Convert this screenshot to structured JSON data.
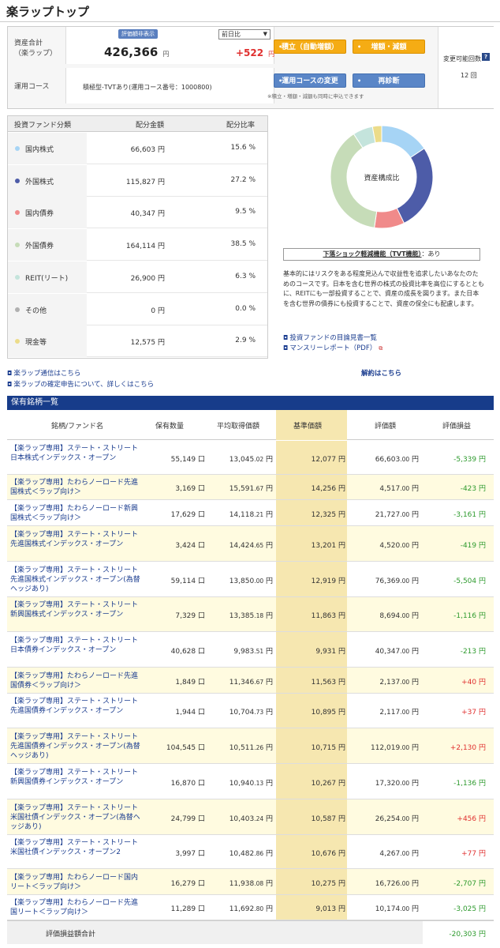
{
  "page": {
    "title": "楽ラップトップ"
  },
  "summary": {
    "asset_total_label_1": "資産合計",
    "asset_total_label_2": "（楽ラップ）",
    "badge": "評価額非表示",
    "total_value": "426,366",
    "yen": "円",
    "compare_select": "前日比",
    "change_value": "+522",
    "course_label": "運用コース",
    "course_value": "積極型-TVTあり(運用コース番号：1000800)",
    "buttons": {
      "accumulate": "積立（自動増額）",
      "increase": "増額・減額",
      "change_course": "運用コースの変更",
      "rediagnose": "再診断"
    },
    "note": "※積立・増額・減額も同時に申込できます",
    "changes_label": "変更可能回数",
    "changes_value": "12 回",
    "help": "?"
  },
  "allocation": {
    "headers": {
      "category": "投資ファンド分類",
      "amount": "配分金額",
      "ratio": "配分比率"
    },
    "rows": [
      {
        "label": "国内株式",
        "amount": "66,603 円",
        "ratio": "15.6 %",
        "color": "#a6d4f5"
      },
      {
        "label": "外国株式",
        "amount": "115,827 円",
        "ratio": "27.2 %",
        "color": "#4d5ca8"
      },
      {
        "label": "国内債券",
        "amount": "40,347 円",
        "ratio": "9.5 %",
        "color": "#f08a8a"
      },
      {
        "label": "外国債券",
        "amount": "164,114 円",
        "ratio": "38.5 %",
        "color": "#c6dcb8"
      },
      {
        "label": "REIT(リート)",
        "amount": "26,900 円",
        "ratio": "6.3 %",
        "color": "#c4e4dc"
      },
      {
        "label": "その他",
        "amount": "0 円",
        "ratio": "0.0 %",
        "color": "#b0b0b0"
      },
      {
        "label": "現金等",
        "amount": "12,575 円",
        "ratio": "2.9 %",
        "color": "#ecdc8a"
      }
    ]
  },
  "donut": {
    "label": "資産構成比"
  },
  "tvt": {
    "label": "下落ショック軽減機能（TVT機能）",
    "value": "：あり"
  },
  "description": "基本的にはリスクをある程度見込んで収益性を追求したいあなたのためのコースです。日本を含む世界の株式の投資比率を高位にするとともに、REITにも一部投資することで、資産の成長を図ります。また日本を含む世界の債券にも投資することで、資産の保全にも配慮します。",
  "links": {
    "prospectus": "投資ファンドの目論見書一覧",
    "monthly": "マンスリーレポート（PDF）",
    "news": "楽ラップ通信はこちら",
    "tax": "楽ラップの確定申告について、詳しくはこちら",
    "cancel": "解約はこちら"
  },
  "holdings": {
    "title": "保有銘柄一覧",
    "headers": [
      "銘柄/ファンド名",
      "保有数量",
      "平均取得価額",
      "基準価額",
      "評価額",
      "評価損益"
    ],
    "rows": [
      {
        "name": "【楽ラップ専用】ステート・ストリート日本株式インデックス・オープン",
        "qty": "55,149 口",
        "avg_main": "13,045",
        "avg_dec": ".02",
        "nav": "12,077 円",
        "val_main": "66,603",
        "val_dec": ".00",
        "pl": "-5,339 円"
      },
      {
        "name": "【楽ラップ専用】たわらノーロード先進国株式＜ラップ向け＞",
        "qty": "3,169 口",
        "avg_main": "15,591",
        "avg_dec": ".67",
        "nav": "14,256 円",
        "val_main": "4,517",
        "val_dec": ".00",
        "pl": "-423 円"
      },
      {
        "name": "【楽ラップ専用】たわらノーロード新興国株式＜ラップ向け＞",
        "qty": "17,629 口",
        "avg_main": "14,118",
        "avg_dec": ".21",
        "nav": "12,325 円",
        "val_main": "21,727",
        "val_dec": ".00",
        "pl": "-3,161 円"
      },
      {
        "name": "【楽ラップ専用】ステート・ストリート先進国株式インデックス・オープン",
        "qty": "3,424 口",
        "avg_main": "14,424",
        "avg_dec": ".65",
        "nav": "13,201 円",
        "val_main": "4,520",
        "val_dec": ".00",
        "pl": "-419 円"
      },
      {
        "name": "【楽ラップ専用】ステート・ストリート先進国株式インデックス・オープン(為替ヘッジあり)",
        "qty": "59,114 口",
        "avg_main": "13,850",
        "avg_dec": ".00",
        "nav": "12,919 円",
        "val_main": "76,369",
        "val_dec": ".00",
        "pl": "-5,504 円"
      },
      {
        "name": "【楽ラップ専用】ステート・ストリート新興国株式インデックス・オープン",
        "qty": "7,329 口",
        "avg_main": "13,385",
        "avg_dec": ".18",
        "nav": "11,863 円",
        "val_main": "8,694",
        "val_dec": ".00",
        "pl": "-1,116 円"
      },
      {
        "name": "【楽ラップ専用】ステート・ストリート日本債券インデックス・オープン",
        "qty": "40,628 口",
        "avg_main": "9,983",
        "avg_dec": ".51",
        "nav": "9,931 円",
        "val_main": "40,347",
        "val_dec": ".00",
        "pl": "-213 円"
      },
      {
        "name": "【楽ラップ専用】たわらノーロード先進国債券＜ラップ向け＞",
        "qty": "1,849 口",
        "avg_main": "11,346",
        "avg_dec": ".67",
        "nav": "11,563 円",
        "val_main": "2,137",
        "val_dec": ".00",
        "pl": "+40 円"
      },
      {
        "name": "【楽ラップ専用】ステート・ストリート先進国債券インデックス・オープン",
        "qty": "1,944 口",
        "avg_main": "10,704",
        "avg_dec": ".73",
        "nav": "10,895 円",
        "val_main": "2,117",
        "val_dec": ".00",
        "pl": "+37 円"
      },
      {
        "name": "【楽ラップ専用】ステート・ストリート先進国債券インデックス・オープン(為替ヘッジあり)",
        "qty": "104,545 口",
        "avg_main": "10,511",
        "avg_dec": ".26",
        "nav": "10,715 円",
        "val_main": "112,019",
        "val_dec": ".00",
        "pl": "+2,130 円"
      },
      {
        "name": "【楽ラップ専用】ステート・ストリート新興国債券インデックス・オープン",
        "qty": "16,870 口",
        "avg_main": "10,940",
        "avg_dec": ".13",
        "nav": "10,267 円",
        "val_main": "17,320",
        "val_dec": ".00",
        "pl": "-1,136 円"
      },
      {
        "name": "【楽ラップ専用】ステート・ストリート米国社債インデックス・オープン(為替ヘッジあり)",
        "qty": "24,799 口",
        "avg_main": "10,403",
        "avg_dec": ".24",
        "nav": "10,587 円",
        "val_main": "26,254",
        "val_dec": ".00",
        "pl": "+456 円"
      },
      {
        "name": "【楽ラップ専用】ステート・ストリート米国社債インデックス・オープン2",
        "qty": "3,997 口",
        "avg_main": "10,482",
        "avg_dec": ".86",
        "nav": "10,676 円",
        "val_main": "4,267",
        "val_dec": ".00",
        "pl": "+77 円"
      },
      {
        "name": "【楽ラップ専用】たわらノーロード国内リート＜ラップ向け＞",
        "qty": "16,279 口",
        "avg_main": "11,938",
        "avg_dec": ".08",
        "nav": "10,275 円",
        "val_main": "16,726",
        "val_dec": ".00",
        "pl": "-2,707 円"
      },
      {
        "name": "【楽ラップ専用】たわらノーロード先進国リート＜ラップ向け＞",
        "qty": "11,289 口",
        "avg_main": "11,692",
        "avg_dec": ".80",
        "nav": "9,013 円",
        "val_main": "10,174",
        "val_dec": ".00",
        "pl": "-3,025 円"
      }
    ],
    "total_label": "評価損益額合計",
    "total_value": "-20,303 円"
  }
}
